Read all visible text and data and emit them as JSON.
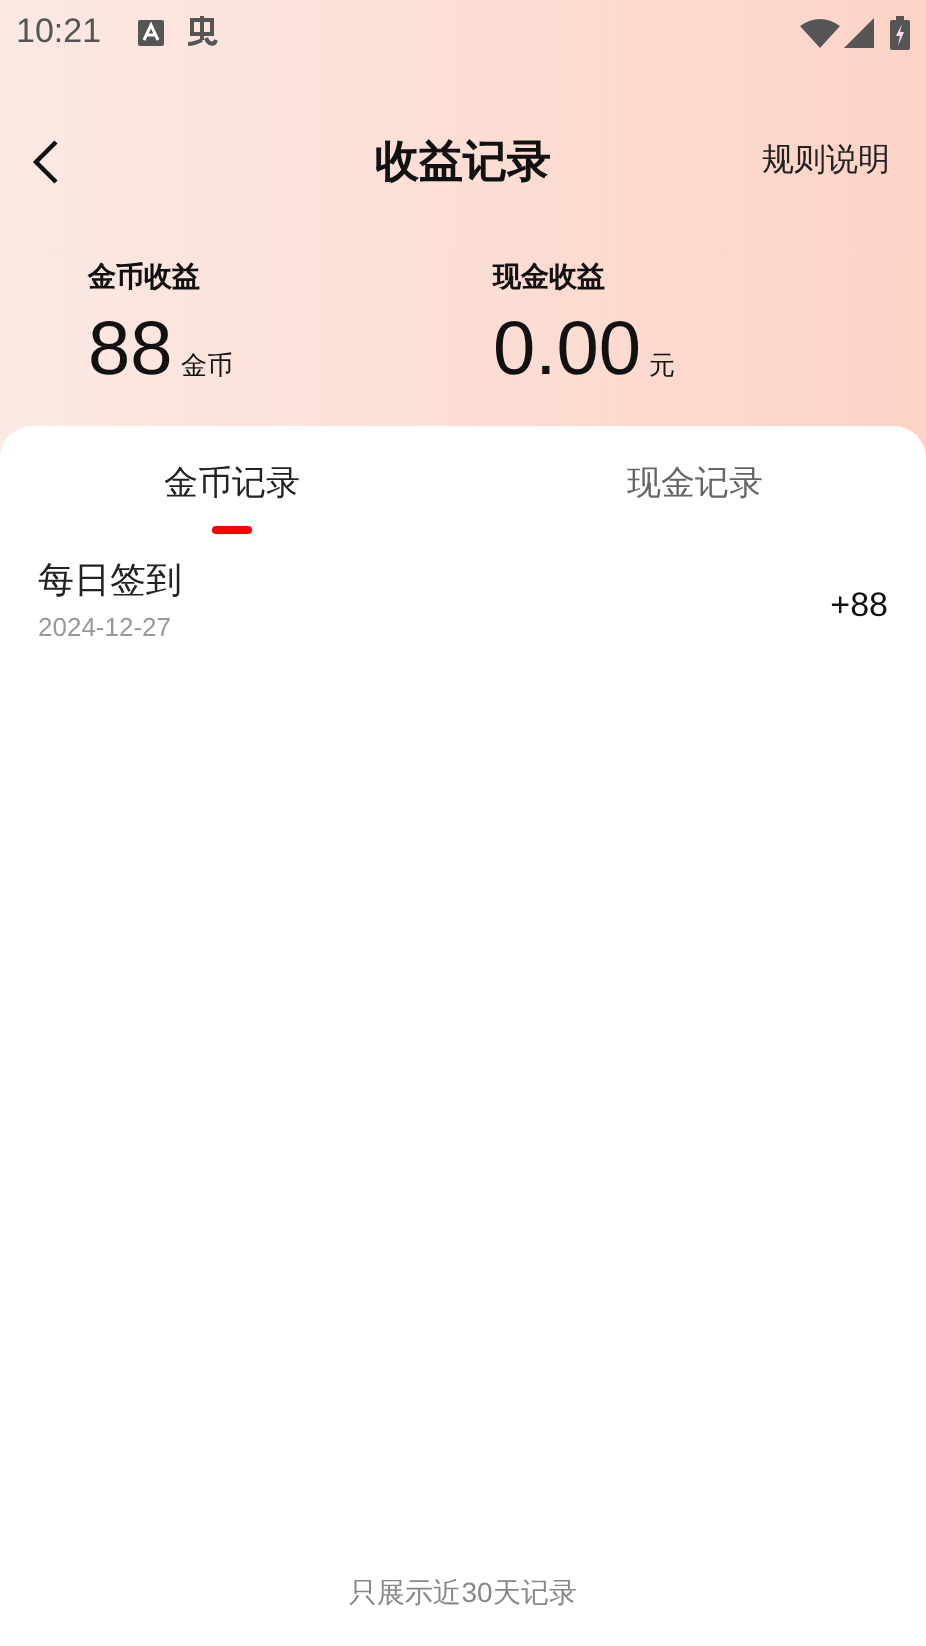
{
  "status_bar": {
    "time": "10:21"
  },
  "header": {
    "title": "收益记录",
    "action": "规则说明"
  },
  "stats": [
    {
      "label": "金币收益",
      "value": "88",
      "unit": "金币"
    },
    {
      "label": "现金收益",
      "value": "0.00",
      "unit": "元"
    }
  ],
  "tabs": [
    {
      "label": "金币记录",
      "selected": true
    },
    {
      "label": "现金记录",
      "selected": false
    }
  ],
  "records": [
    {
      "title": "每日签到",
      "date": "2024-12-27",
      "amount": "+88"
    }
  ],
  "footer_note": "只展示近30天记录"
}
